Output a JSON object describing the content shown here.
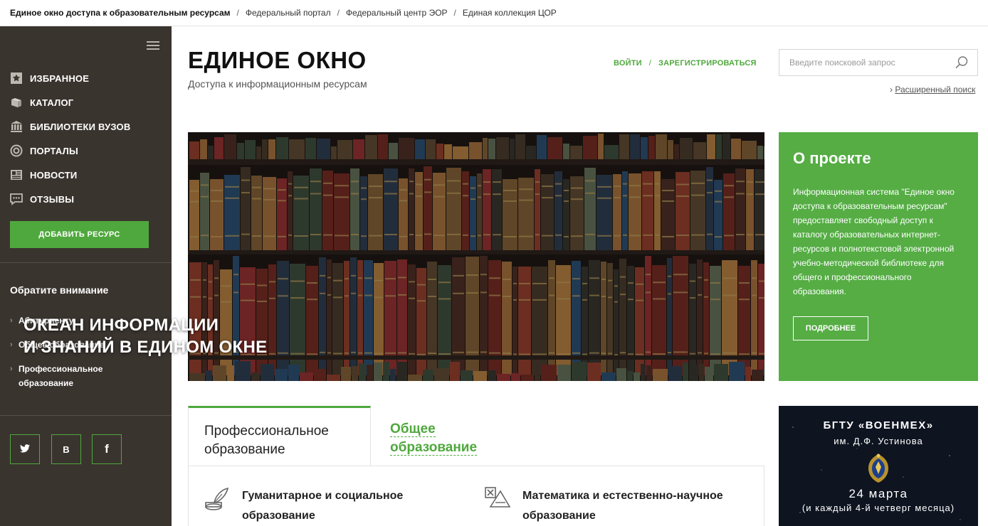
{
  "breadcrumbs": [
    "Единое окно доступа к образовательным ресурсам",
    "Федеральный портал",
    "Федеральный центр ЭОР",
    "Единая коллекция ЦОР"
  ],
  "sidebar": {
    "menu": [
      {
        "label": "ИЗБРАННОЕ",
        "icon": "star-icon"
      },
      {
        "label": "КАТАЛОГ",
        "icon": "books-icon"
      },
      {
        "label": "БИБЛИОТЕКИ ВУЗОВ",
        "icon": "library-icon"
      },
      {
        "label": "ПОРТАЛЫ",
        "icon": "portal-icon"
      },
      {
        "label": "НОВОСТИ",
        "icon": "news-icon"
      },
      {
        "label": "ОТЗЫВЫ",
        "icon": "comment-icon"
      }
    ],
    "add_button": "ДОБАВИТЬ РЕСУРС",
    "attention_title": "Обратите внимание",
    "attention_items": [
      "Абитуриенту",
      "Общее образование",
      "Профессиональное образование"
    ],
    "social": [
      {
        "name": "twitter-icon",
        "glyph": ""
      },
      {
        "name": "vk-icon",
        "glyph": "В"
      },
      {
        "name": "facebook-icon",
        "glyph": "f"
      }
    ]
  },
  "header": {
    "title": "ЕДИНОЕ ОКНО",
    "subtitle": "Доступа к информационным ресурсам",
    "login": "ВОЙТИ",
    "auth_separator": "/",
    "register": "ЗАРЕГИСТРИРОВАТЬСЯ",
    "search_placeholder": "Введите поисковой запрос",
    "advanced_search": "Расширенный поиск"
  },
  "hero": {
    "line1": "ОКЕАН ИНФОРМАЦИИ",
    "line2": "И ЗНАНИЙ В ЕДИНОМ ОКНЕ"
  },
  "about": {
    "title": "О проекте",
    "text": "Информационная система \"Единое окно доступа к образовательным ресурсам\" предоставляет свободный доступ к каталогу образовательных интернет-ресурсов и полнотекстовой электронной учебно-методической библиотеке для общего и профессионального образования.",
    "more": "ПОДРОБНЕЕ"
  },
  "tabs": {
    "active_line1": "Профессиональное",
    "active_line2": "образование",
    "inactive_line1": "Общее",
    "inactive_line2": "образование"
  },
  "categories": [
    {
      "line1": "Гуманитарное и социальное",
      "line2": "образование",
      "icon": "quill-icon"
    },
    {
      "line1": "Математика и естественно-научное",
      "line2": "образование",
      "icon": "math-icon"
    }
  ],
  "banner": {
    "title": "БГТУ «ВОЕНМЕХ»",
    "subtitle": "им. Д.Ф. Устинова",
    "date": "24 марта",
    "note": "(и каждый 4-й четверг месяца)"
  },
  "colors": {
    "accent": "#4fa83d",
    "sidebar": "#3a342f",
    "about_bg": "#55ad44"
  }
}
